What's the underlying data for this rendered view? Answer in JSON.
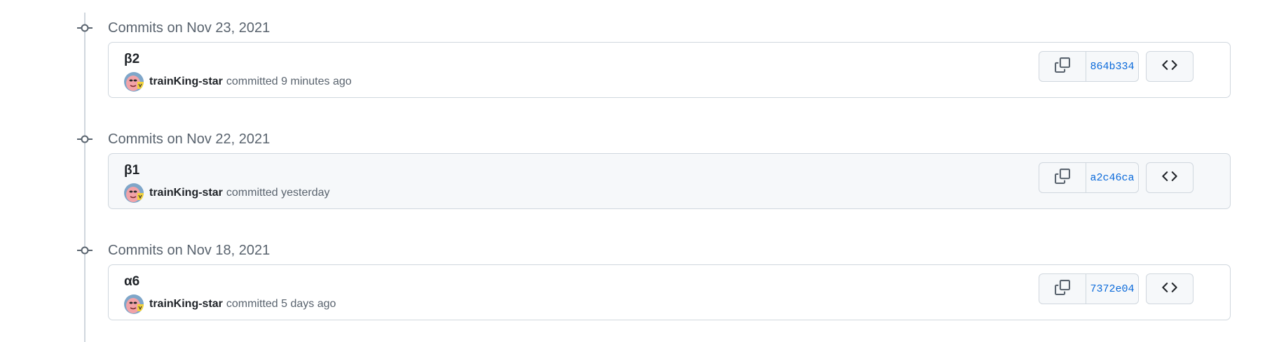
{
  "groups": [
    {
      "date_label": "Commits on Nov 23, 2021",
      "commit": {
        "title": "β2",
        "author": "trainKing-star",
        "action": "committed 9 minutes ago",
        "sha": "864b334"
      }
    },
    {
      "date_label": "Commits on Nov 22, 2021",
      "commit": {
        "title": "β1",
        "author": "trainKing-star",
        "action": "committed yesterday",
        "sha": "a2c46ca"
      }
    },
    {
      "date_label": "Commits on Nov 18, 2021",
      "commit": {
        "title": "α6",
        "author": "trainKing-star",
        "action": "committed 5 days ago",
        "sha": "7372e04"
      }
    }
  ],
  "icons": {
    "commit_node": "git-commit-icon",
    "copy": "copy-icon",
    "browse": "code-icon"
  },
  "colors": {
    "sha_link": "#0969da",
    "muted_text": "#59636e",
    "border": "#d0d7de",
    "hover_bg": "#f6f8fa"
  }
}
